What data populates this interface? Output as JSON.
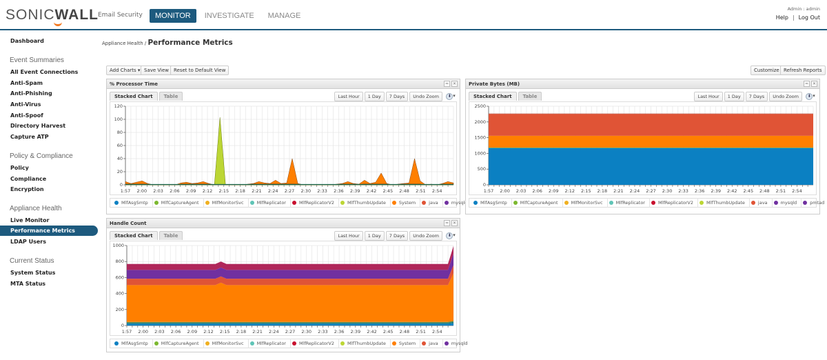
{
  "header": {
    "brand": {
      "part1": "SONIC",
      "part2": "WALL"
    },
    "product": "Email Security",
    "tabs": [
      {
        "label": "MONITOR",
        "active": true
      },
      {
        "label": "INVESTIGATE",
        "active": false
      },
      {
        "label": "MANAGE",
        "active": false
      }
    ],
    "user": "Admin : admin",
    "help": "Help",
    "separator": "|",
    "logout": "Log Out"
  },
  "sidebar": {
    "dashboard": "Dashboard",
    "sections": [
      {
        "title": "Event Summaries",
        "items": [
          "All Event Connections",
          "Anti-Spam",
          "Anti-Phishing",
          "Anti-Virus",
          "Anti-Spoof",
          "Directory Harvest",
          "Capture ATP"
        ]
      },
      {
        "title": "Policy & Compliance",
        "items": [
          "Policy",
          "Compliance",
          "Encryption"
        ]
      },
      {
        "title": "Appliance Health",
        "items": [
          "Live Monitor",
          "Performance Metrics",
          "LDAP Users"
        ],
        "active": "Performance Metrics"
      },
      {
        "title": "Current Status",
        "items": [
          "System Status",
          "MTA Status"
        ]
      }
    ]
  },
  "breadcrumb": {
    "parent": "Appliance Health",
    "sep": " / ",
    "current": "Performance Metrics"
  },
  "toolbar": {
    "add_charts": "Add Charts ▾",
    "save_view": "Save View",
    "reset_view": "Reset to Default View",
    "customize": "Customize",
    "refresh": "Refresh Reports"
  },
  "panel_common": {
    "tab_chart": "Stacked Chart",
    "tab_table": "Table",
    "btn_last_hour": "Last Hour",
    "btn_1day": "1 Day",
    "btn_7days": "7 Days",
    "btn_undo_zoom": "Undo Zoom",
    "collapse_icon": "≈",
    "close_icon": "✕",
    "download_icon": "⬇",
    "dropdown_caret": "▾"
  },
  "colors": {
    "accent": "#1d5a7e",
    "MlfAsgSmtp": "#0b80c2",
    "MlfCaptureAgent": "#7cb82f",
    "MlfMonitorSvc": "#f0b020",
    "MlfReplicator": "#5fc4b6",
    "MlfReplicatorV2": "#c8102e",
    "MlfThumbUpdate": "#bcd634",
    "System": "#ff7f00",
    "java": "#e05436",
    "mysqld": "#7030a0",
    "pmtad": "#7030a0"
  },
  "chart_data": [
    {
      "type": "area",
      "title": "% Processor Time",
      "stacked": true,
      "xlabel": "",
      "ylabel": "",
      "ylim": [
        0,
        120
      ],
      "yticks": [
        0,
        20,
        40,
        60,
        80,
        100,
        120
      ],
      "x_tick_labels": [
        "1:57",
        "2:00",
        "2:03",
        "2:06",
        "2:09",
        "2:12",
        "2:15",
        "2:18",
        "2:21",
        "2:24",
        "2:27",
        "2:30",
        "2:33",
        "2:36",
        "2:39",
        "2:42",
        "2:45",
        "2:48",
        "2:51",
        "2:54"
      ],
      "grid": true,
      "legend_position": "bottom",
      "legend": [
        "MlfAsgSmtp",
        "MlfCaptureAgent",
        "MlfMonitorSvc",
        "MlfReplicator",
        "MlfReplicatorV2",
        "MlfThumbUpdate",
        "System",
        "java",
        "mysqld"
      ],
      "x_points": 60,
      "series": [
        {
          "name": "MlfThumbUpdate",
          "values": [
            0,
            0,
            0,
            0,
            0,
            0,
            0,
            0,
            0,
            0,
            0,
            0,
            0,
            0,
            0,
            0,
            0,
            0,
            0,
            0,
            0,
            0,
            0,
            0,
            0,
            0,
            0,
            0,
            0,
            0,
            0,
            0,
            0,
            0,
            0,
            0,
            0,
            0,
            0,
            0,
            0,
            0,
            0,
            0,
            0,
            0,
            0,
            0,
            0,
            0,
            0,
            0,
            0,
            0,
            0,
            0,
            0,
            0,
            0,
            0
          ],
          "peak": {
            "index": 17,
            "value": 103
          }
        },
        {
          "name": "System",
          "values": [
            5,
            2,
            4,
            6,
            2,
            0,
            0,
            0,
            0,
            0,
            3,
            4,
            2,
            3,
            5,
            2,
            0,
            1,
            0,
            0,
            0,
            0,
            1,
            2,
            5,
            3,
            2,
            7,
            2,
            3,
            40,
            2,
            0,
            0,
            0,
            0,
            0,
            0,
            1,
            2,
            5,
            2,
            1,
            7,
            2,
            4,
            18,
            2,
            0,
            1,
            2,
            3,
            40,
            6,
            0,
            1,
            0,
            2,
            5,
            3
          ]
        }
      ]
    },
    {
      "type": "area",
      "title": "Private Bytes (MB)",
      "stacked": true,
      "ylim": [
        0,
        2500
      ],
      "yticks": [
        0,
        500,
        1000,
        1500,
        2000,
        2500
      ],
      "x_tick_labels": [
        "1:57",
        "2:00",
        "2:03",
        "2:06",
        "2:09",
        "2:12",
        "2:15",
        "2:18",
        "2:21",
        "2:24",
        "2:27",
        "2:30",
        "2:33",
        "2:36",
        "2:39",
        "2:42",
        "2:45",
        "2:48",
        "2:51",
        "2:54"
      ],
      "grid": true,
      "legend_position": "bottom",
      "legend": [
        "MlfAsgSmtp",
        "MlfCaptureAgent",
        "MlfMonitorSvc",
        "MlfReplicator",
        "MlfReplicatorV2",
        "MlfThumbUpdate",
        "java",
        "mysqld",
        "pmtad"
      ],
      "series": [
        {
          "name": "MlfAsgSmtp",
          "value_constant": 1170
        },
        {
          "name": "MlfCaptureAgent",
          "value_constant": 15
        },
        {
          "name": "java",
          "value_constant": 375
        },
        {
          "name": "mysqld",
          "value_constant": 695
        },
        {
          "name": "pmtad",
          "value_constant": 10
        }
      ]
    },
    {
      "type": "area",
      "title": "Handle Count",
      "stacked": true,
      "ylim": [
        0,
        1000
      ],
      "yticks": [
        0,
        200,
        400,
        600,
        800,
        1000
      ],
      "x_tick_labels": [
        "1:57",
        "2:00",
        "2:03",
        "2:06",
        "2:09",
        "2:12",
        "2:15",
        "2:18",
        "2:21",
        "2:24",
        "2:27",
        "2:30",
        "2:33",
        "2:36",
        "2:39",
        "2:42",
        "2:45",
        "2:48",
        "2:51",
        "2:54"
      ],
      "grid": true,
      "legend_position": "bottom",
      "legend": [
        "MlfAsgSmtp",
        "MlfCaptureAgent",
        "MlfMonitorSvc",
        "MlfReplicator",
        "MlfReplicatorV2",
        "MlfThumbUpdate",
        "System",
        "java",
        "mysqld"
      ],
      "series": [
        {
          "name": "MlfAsgSmtp",
          "value_constant": 20
        },
        {
          "name": "MlfReplicator",
          "value_constant": 15
        },
        {
          "name": "MlfCaptureAgent",
          "value_constant": 10
        },
        {
          "name": "System",
          "value_constant": 460,
          "bump_at_2_14": 30
        },
        {
          "name": "java",
          "value_constant": 80
        },
        {
          "name": "mysqld",
          "value_constant": 110
        },
        {
          "name": "MlfReplicatorV2",
          "value_constant": 75
        },
        {
          "name": "final_point_total",
          "value": 990
        }
      ]
    }
  ]
}
